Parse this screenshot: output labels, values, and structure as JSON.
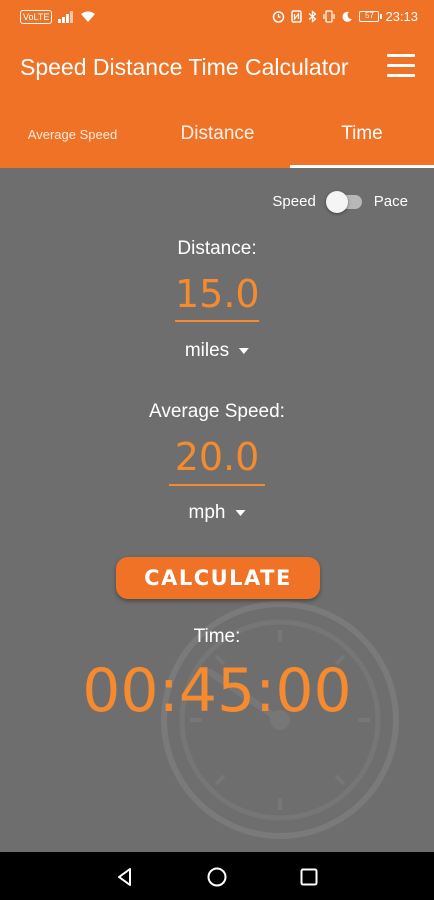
{
  "status_bar": {
    "volte": "VoLTE",
    "signal": "4G",
    "time": "23:13",
    "battery": "57"
  },
  "app_bar": {
    "title": "Speed Distance Time Calculator",
    "menu_icon": "hamburger-menu-icon"
  },
  "tabs": [
    {
      "label": "Average Speed",
      "selected": false
    },
    {
      "label": "Distance",
      "selected": false
    },
    {
      "label": "Time",
      "selected": true
    }
  ],
  "mode_toggle": {
    "left_label": "Speed",
    "right_label": "Pace",
    "is_on": false
  },
  "distance": {
    "label": "Distance:",
    "value": "15.0",
    "unit": "miles"
  },
  "speed": {
    "label": "Average Speed:",
    "value": "20.0",
    "unit": "mph"
  },
  "calculate_label": "CALCULATE",
  "result": {
    "label": "Time:",
    "value": "00:45:00"
  },
  "colors": {
    "accent": "#f07226",
    "value_text": "#f58a2e",
    "background": "#6e6e6e"
  },
  "nav_bar": {
    "icons": [
      "back-icon",
      "home-icon",
      "recents-icon"
    ]
  }
}
